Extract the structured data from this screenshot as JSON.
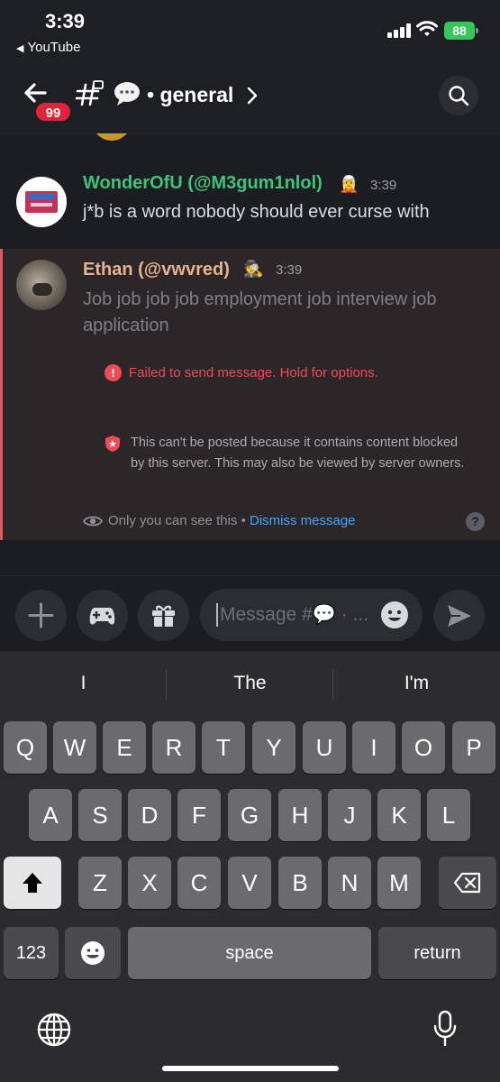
{
  "status_bar": {
    "time": "3:39",
    "back_app": "YouTube",
    "battery": "88"
  },
  "header": {
    "badge": "99",
    "channel_name": "general"
  },
  "messages": [
    {
      "author": "WonderOfU (@M3gum1nlol)",
      "emoji": "🧝",
      "time": "3:39",
      "text": "j*b is a word nobody should ever curse with"
    },
    {
      "author": "Ethan (@vwvred)",
      "emoji": "🕵️",
      "time": "3:39",
      "text": "Job job job job employment job interview job application"
    }
  ],
  "failed": {
    "error": "Failed to send message. Hold for options.",
    "blocked": "This can't be posted because it contains content blocked by this server. This may also be viewed by server owners.",
    "only_you": "Only you can see this • ",
    "dismiss": "Dismiss message"
  },
  "composer": {
    "placeholder": "Message #💬 · ..."
  },
  "keyboard": {
    "suggestions": [
      "I",
      "The",
      "I'm"
    ],
    "row1": [
      "Q",
      "W",
      "E",
      "R",
      "T",
      "Y",
      "U",
      "I",
      "O",
      "P"
    ],
    "row2": [
      "A",
      "S",
      "D",
      "F",
      "G",
      "H",
      "J",
      "K",
      "L"
    ],
    "row3": [
      "Z",
      "X",
      "C",
      "V",
      "B",
      "N",
      "M"
    ],
    "numbers_key": "123",
    "space_key": "space",
    "return_key": "return"
  },
  "colors": {
    "accent_link": "#3ba7ff",
    "error": "#ef4a56",
    "badge": "#e0233a",
    "username_green": "#3ec47a",
    "username_tan": "#e3b48f"
  }
}
